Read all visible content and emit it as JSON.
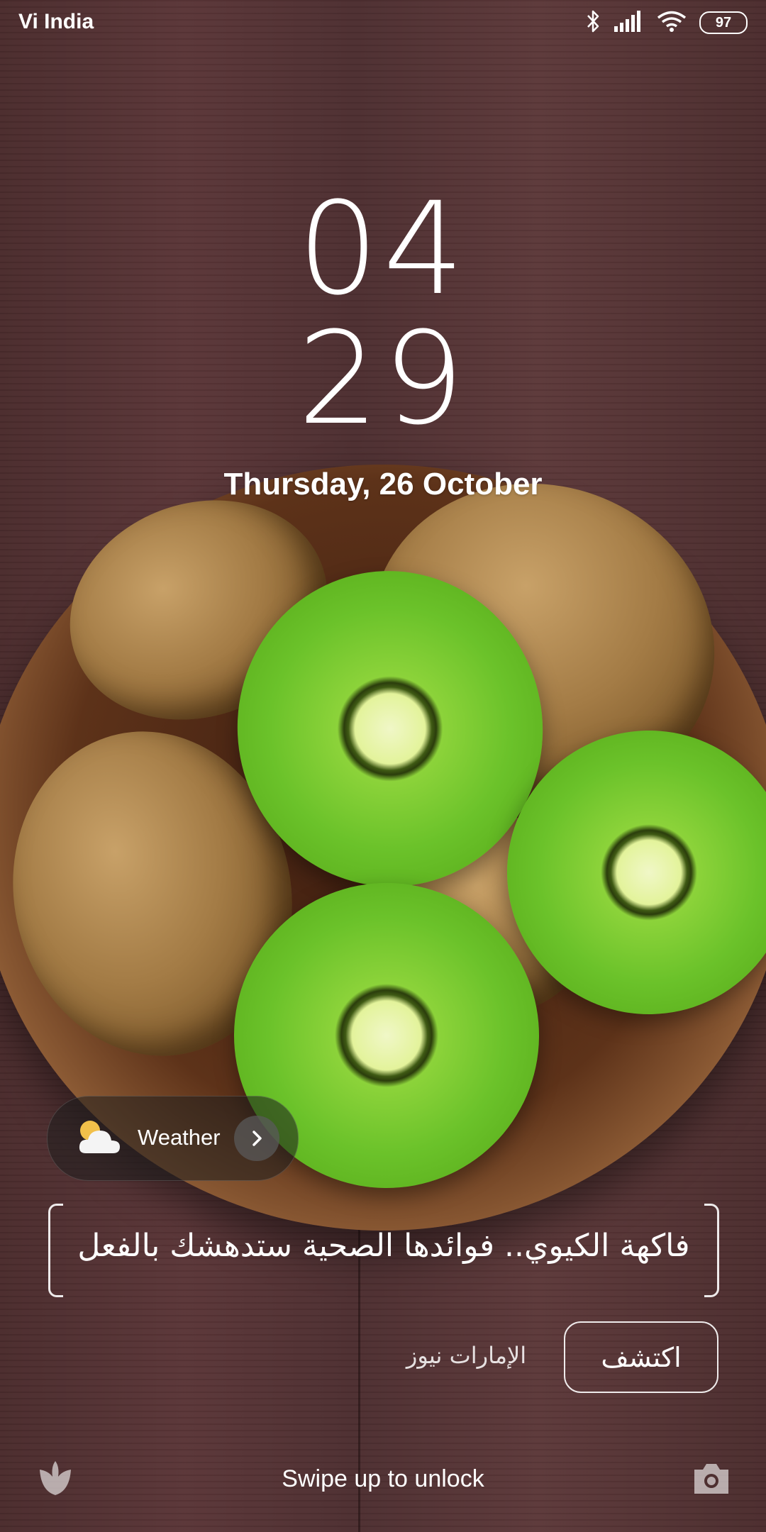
{
  "status_bar": {
    "carrier": "Vi India",
    "battery": "97",
    "icons": [
      "bluetooth-icon",
      "signal-icon",
      "wifi-icon",
      "battery-icon"
    ]
  },
  "clock": {
    "hour": "04",
    "minute": "29",
    "date": "Thursday, 26 October"
  },
  "weather": {
    "label": "Weather",
    "icon": "cloud-sun-icon"
  },
  "news": {
    "headline": "فاكهة الكيوي.. فوائدها الصحية ستدهشك بالفعل",
    "source": "الإمارات نيوز",
    "discover_label": "اكتشف"
  },
  "bottom": {
    "swipe_hint": "Swipe up to unlock",
    "left_icon": "tulip-icon",
    "right_icon": "camera-icon"
  }
}
